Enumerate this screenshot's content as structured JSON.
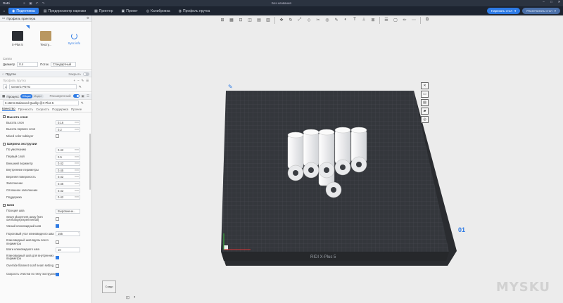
{
  "app": {
    "name": "RaBi",
    "title": "Без названия"
  },
  "menubar": {
    "tabs": [
      {
        "label": "Подготовка",
        "icon": "home-icon"
      },
      {
        "label": "Предпросмотр нарезки",
        "icon": "preview-icon"
      },
      {
        "label": "Принтер",
        "icon": "printer-icon"
      },
      {
        "label": "Проект",
        "icon": "project-icon"
      },
      {
        "label": "Калибровка",
        "icon": "calibration-icon"
      },
      {
        "label": "Профиль прутка",
        "icon": "filament-icon"
      }
    ],
    "slice_label": "Нарезать стол",
    "print_label": "Распечатать стол"
  },
  "printer_section": {
    "title": "Профиль принтера",
    "printer_name": "X-Plus 5",
    "texture_name": "Тексту...",
    "sync_label": "Sync info"
  },
  "nozzle": {
    "section_label": "Сопло",
    "diameter_label": "Диаметр",
    "diameter_value": "0.4",
    "flow_label": "Поток",
    "flow_value": "Стандартный"
  },
  "filament": {
    "title": "Пруток",
    "close_label": "Закрыть",
    "profile_placeholder": "Профиль прутка",
    "slot": "1",
    "material": "Generic PETG"
  },
  "process": {
    "title": "Процесс",
    "seg_general": "Общие",
    "seg_other": "Модел",
    "advanced_label": "Расширенный",
    "profile": "0.16mm Balanced Quality @X-Plus 5",
    "tabs": [
      "Качество",
      "Прочность",
      "Скорость",
      "Поддержка",
      "Прочее"
    ]
  },
  "layer_height": {
    "title": "Высота слоя",
    "params": [
      {
        "label": "Высота слоя",
        "value": "0.16",
        "unit": "mm"
      },
      {
        "label": "Высота первого слоя",
        "value": "0.2",
        "unit": "mm"
      }
    ],
    "mixed_label": "Mixed color sublayer"
  },
  "line_width": {
    "title": "Ширина экструзии",
    "params": [
      {
        "label": "По умолчанию",
        "value": "0.42",
        "unit": "mm"
      },
      {
        "label": "Первый слой",
        "value": "0.5",
        "unit": "mm"
      },
      {
        "label": "Внешний периметр",
        "value": "0.42",
        "unit": "mm"
      },
      {
        "label": "Внутренние периметры",
        "value": "0.45",
        "unit": "mm"
      },
      {
        "label": "Верхняя поверхность",
        "value": "0.42",
        "unit": "mm"
      },
      {
        "label": "Заполнение",
        "value": "0.45",
        "unit": "mm"
      },
      {
        "label": "Сплошное заполнение",
        "value": "0.42",
        "unit": "mm"
      },
      {
        "label": "Поддержка",
        "value": "0.42",
        "unit": "mm"
      }
    ]
  },
  "seam": {
    "title": "Шов",
    "position_label": "Позиция шва",
    "position_value": "Выровненн...",
    "away_label": "Seam placement away from overhangs(experimental)",
    "smart_label": "Умный клиновидный шов",
    "threshold_label": "Пороговый угол клиновидного шва",
    "threshold_value": "155",
    "threshold_unit": "°",
    "whole_label": "Клиновидный шов вдоль всего периметра",
    "step_label": "Шаги клиновидного шва",
    "step_value": "10",
    "inner_label": "Клиновидный шов для внутренних периметра",
    "override_label": "Override filament scarf seam setting",
    "wipe_label": "Скорость очистки по типу экструзии"
  },
  "viewport": {
    "plate_number": "01",
    "plate_brand": "RIDI X-Plus 5",
    "navcube_label": "Сзади"
  },
  "watermark": "MYSKU"
}
